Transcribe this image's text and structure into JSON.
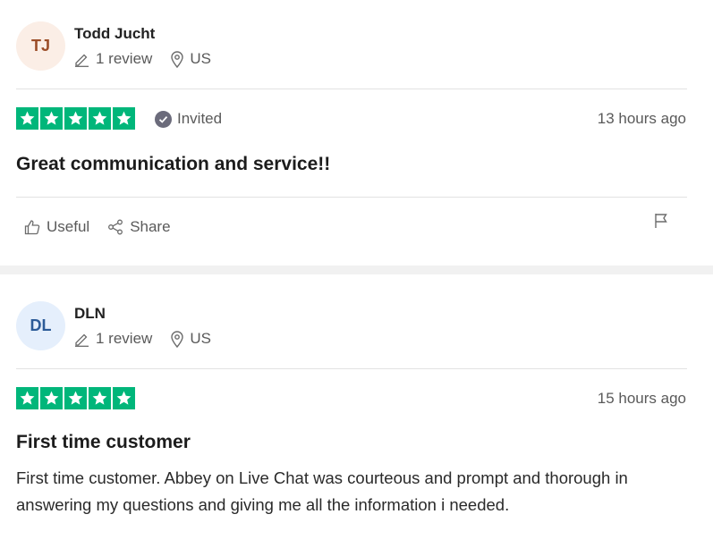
{
  "reviews": [
    {
      "initials": "TJ",
      "name": "Todd Jucht",
      "review_count": "1 review",
      "country": "US",
      "rating": 5,
      "invited_label": "Invited",
      "date": "13 hours ago",
      "title": "Great communication and service!!",
      "useful_label": "Useful",
      "share_label": "Share"
    },
    {
      "initials": "DL",
      "name": "DLN",
      "review_count": "1 review",
      "country": "US",
      "rating": 5,
      "date": "15 hours ago",
      "title": "First time customer",
      "body": "First time customer. Abbey on Live Chat was courteous and prompt and thorough in answering my questions and giving me all the information i needed."
    }
  ],
  "colors": {
    "star_green": "#00b67a",
    "avatar_tj_bg": "#fbeee6",
    "avatar_dl_bg": "#e5effc"
  }
}
